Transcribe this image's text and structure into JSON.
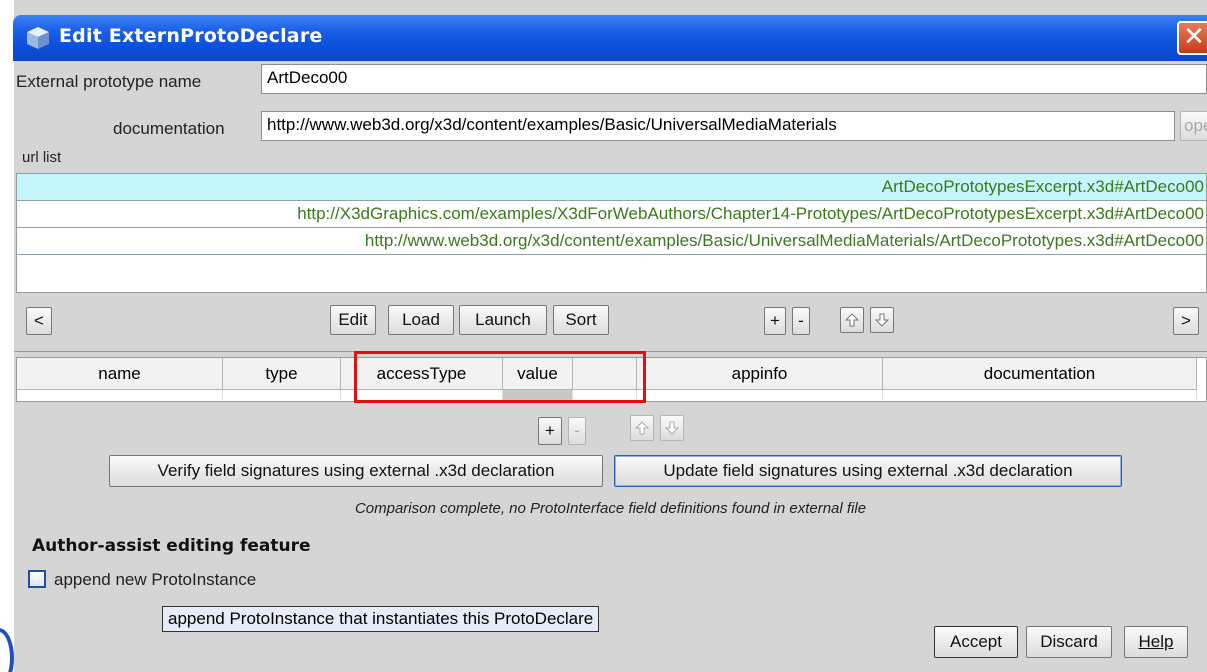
{
  "window": {
    "title": "Edit ExternProtoDeclare",
    "close_glyph": "✕"
  },
  "form": {
    "name_label": "External prototype name",
    "name_value": "ArtDeco00",
    "doc_label": "documentation",
    "doc_value": "http://www.web3d.org/x3d/content/examples/Basic/UniversalMediaMaterials",
    "open_label": "open"
  },
  "url_list": {
    "label": "url list",
    "items": [
      "ArtDecoPrototypesExcerpt.x3d#ArtDeco00",
      "http://X3dGraphics.com/examples/X3dForWebAuthors/Chapter14-Prototypes/ArtDecoPrototypesExcerpt.x3d#ArtDeco00",
      "http://www.web3d.org/x3d/content/examples/Basic/UniversalMediaMaterials/ArtDecoPrototypes.x3d#ArtDeco00"
    ],
    "selected_index": 0
  },
  "url_toolbar": {
    "prev": "<",
    "edit": "Edit",
    "load": "Load",
    "launch": "Launch",
    "sort": "Sort",
    "add": "+",
    "remove": "-",
    "next": ">"
  },
  "field_table": {
    "columns": [
      "name",
      "type",
      "accessType",
      "value",
      "",
      "appinfo",
      "documentation"
    ]
  },
  "field_toolbar": {
    "add": "+",
    "remove": "-"
  },
  "actions": {
    "verify": "Verify field signatures using external .x3d declaration",
    "update": "Update field signatures using external .x3d declaration",
    "status": "Comparison complete, no ProtoInterface field definitions found in external file"
  },
  "author_assist": {
    "heading": "Author-assist editing feature",
    "checkbox_label": "append new ProtoInstance",
    "checked": false,
    "tooltip": "append ProtoInstance that instantiates this ProtoDeclare"
  },
  "footer": {
    "accept": "Accept",
    "discard": "Discard",
    "help": "Help"
  },
  "colors": {
    "title_blue": "#0c4fd8",
    "url_text_green": "#3a7a1a",
    "selected_row": "#c5f6fb",
    "highlight_red": "#e01010"
  }
}
